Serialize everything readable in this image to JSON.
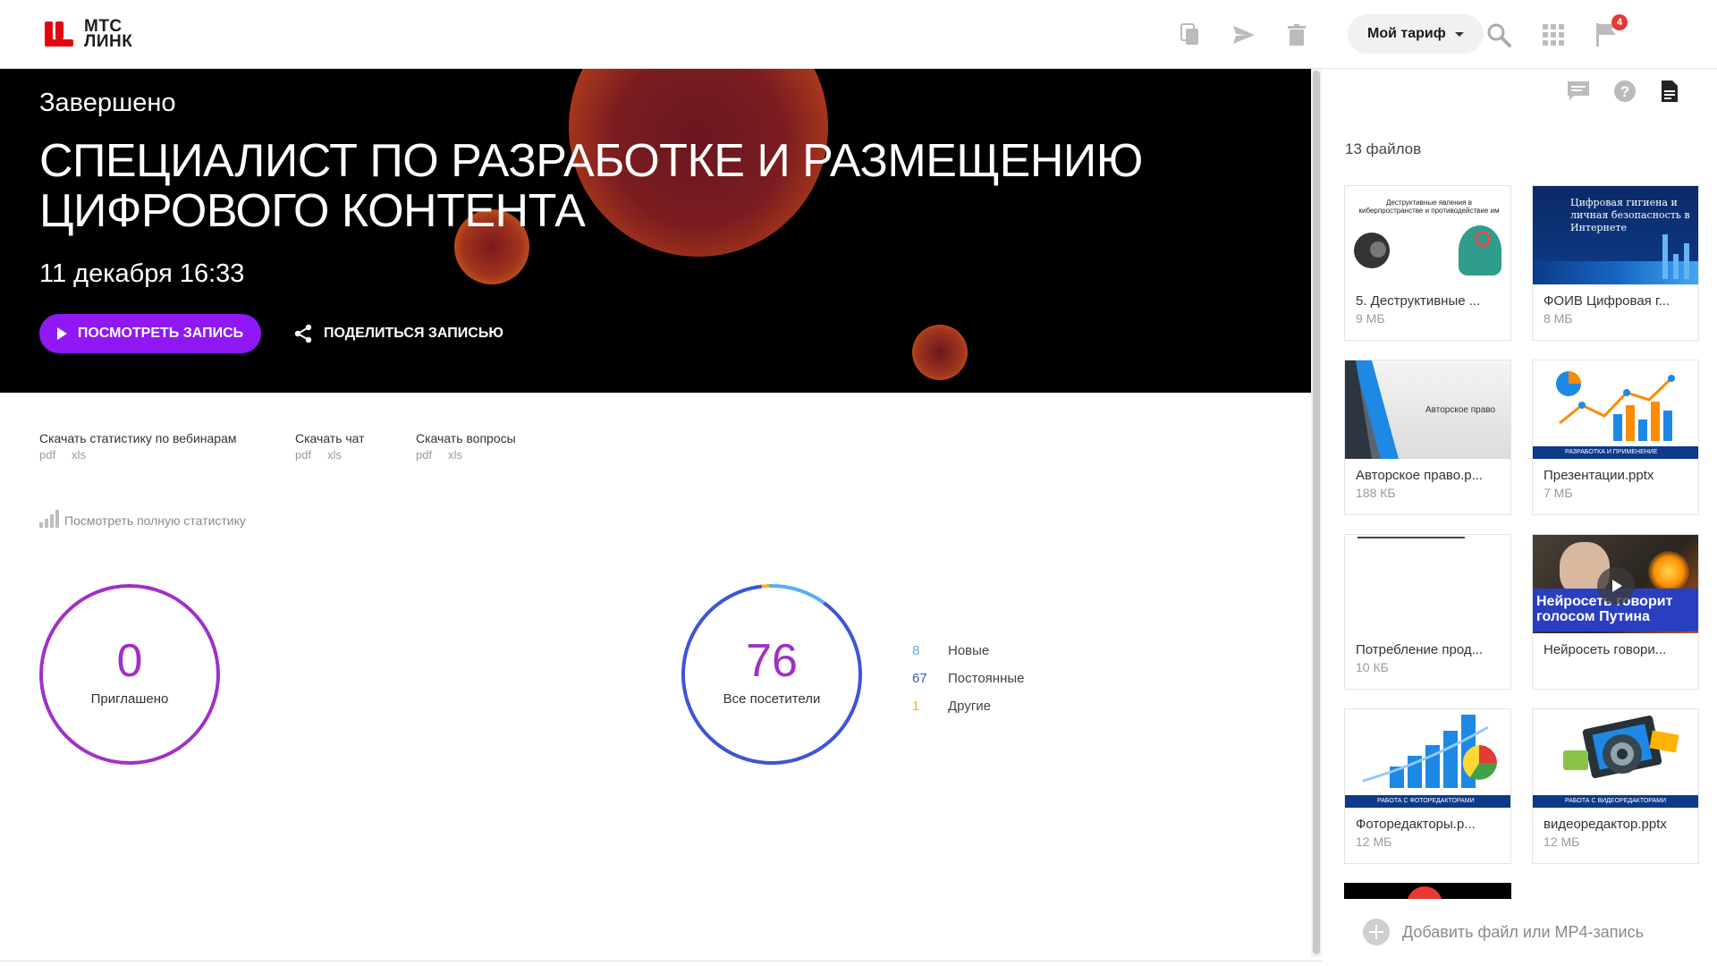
{
  "brand": {
    "line1": "МТС",
    "line2": "ЛИНК",
    "color": "#e30611"
  },
  "topbar": {
    "icons": [
      "copy-icon",
      "send-icon",
      "trash-icon"
    ],
    "tariff_label": "Мой тариф",
    "right_icons": [
      "search-icon",
      "apps-grid-icon",
      "flag-icon"
    ],
    "notifications_count": "4"
  },
  "hero": {
    "status": "Завершено",
    "title": "Специалист по разработке и размещению цифрового контента",
    "date": "11 декабря 16:33",
    "watch_label": "ПОСМОТРЕТЬ ЗАПИСЬ",
    "share_label": "ПОДЕЛИТЬСЯ ЗАПИСЬЮ",
    "accent": "#8f18f5"
  },
  "downloads": [
    {
      "label": "Скачать статистику по вебинарам",
      "pdf": "pdf",
      "xls": "xls"
    },
    {
      "label": "Скачать чат",
      "pdf": "pdf",
      "xls": "xls"
    },
    {
      "label": "Скачать вопросы",
      "pdf": "pdf",
      "xls": "xls"
    }
  ],
  "full_stats_label": "Посмотреть полную статистику",
  "invited": {
    "value": "0",
    "label": "Приглашено",
    "color": "#a030c8"
  },
  "attendees": {
    "total": "76",
    "label": "Все посетители",
    "legend": [
      {
        "count": "8",
        "label": "Новые",
        "color": "#5aaef0"
      },
      {
        "count": "67",
        "label": "Постоянные",
        "color": "#3d55d6"
      },
      {
        "count": "1",
        "label": "Другие",
        "color": "#f2b233"
      }
    ],
    "segments": {
      "new": 8,
      "regular": 67,
      "other": 1
    }
  },
  "right_panel": {
    "icons": [
      "chat-icon",
      "help-icon",
      "document-icon"
    ],
    "files_count": "13 файлов",
    "files": [
      {
        "name": "5. Деструктивные ...",
        "size": "9 МБ",
        "thumb_text": "Деструктивные явления в киберпространстве и противодействие им"
      },
      {
        "name": "ФОИВ Цифровая г...",
        "size": "8 МБ",
        "thumb_text": "Цифровая гигиена и личная безопасность в Интернете"
      },
      {
        "name": "Авторское право.p...",
        "size": "188 КБ",
        "thumb_text": "Авторское право"
      },
      {
        "name": "Презентации.pptx",
        "size": "7 МБ",
        "thumb_text": "РАЗРАБОТКА И ПРИМЕНЕНИЕ"
      },
      {
        "name": "Потребление прод...",
        "size": "10 КБ",
        "thumb_text": ""
      },
      {
        "name": "Нейросеть говори...",
        "size": "",
        "thumb_text": "Нейросеть говорит голосом Путина"
      },
      {
        "name": "Фоторедакторы.p...",
        "size": "12 МБ",
        "thumb_text": "РАБОТА С ФОТОРЕДАКТОРАМИ"
      },
      {
        "name": "видеоредактор.pptx",
        "size": "12 МБ",
        "thumb_text": "РАБОТА С ВИДЕОРЕДАКТОРАМИ"
      }
    ],
    "add_label": "Добавить файл или MP4-запись"
  }
}
